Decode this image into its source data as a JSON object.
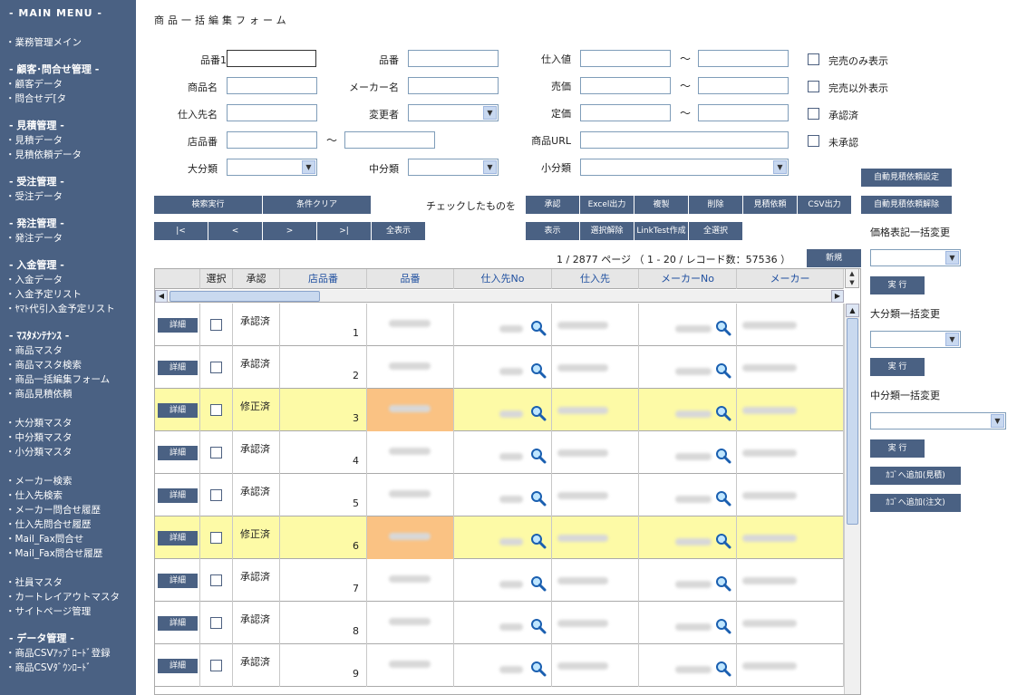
{
  "sidebar": {
    "main_menu": "- MAIN MENU -",
    "top_item": "・業務管理メイン",
    "groups": [
      {
        "title": "- 顧客･問合せ管理 -",
        "items": [
          "・顧客データ",
          "・問合せデ[タ"
        ]
      },
      {
        "title": "- 見積管理 -",
        "items": [
          "・見積データ",
          "・見積依頼データ"
        ]
      },
      {
        "title": "- 受注管理 -",
        "items": [
          "・受注データ"
        ]
      },
      {
        "title": "- 発注管理 -",
        "items": [
          "・発注データ"
        ]
      },
      {
        "title": "- 入金管理 -",
        "items": [
          "・入金データ",
          "・入金予定リスト",
          "・ﾔﾏﾄ代引入金予定リスト"
        ]
      },
      {
        "title": "- ﾏｽﾀﾒﾝﾃﾅﾝｽ -",
        "items": [
          "・商品マスタ",
          "・商品マスタ検索",
          "・商品一括編集フォーム",
          "・商品見積依頼",
          "",
          "・大分類マスタ",
          "・中分類マスタ",
          "・小分類マスタ",
          "",
          "・メーカー検索",
          "・仕入先検索",
          "・メーカー問合せ履歴",
          "・仕入先問合せ履歴",
          "・Mail_Fax問合せ",
          "・Mail_Fax問合せ履歴",
          "",
          "・社員マスタ",
          "・カートレイアウトマスタ",
          "・サイトページ管理"
        ]
      },
      {
        "title": "- データ管理 -",
        "items": [
          "・商品CSVｱｯﾌﾟﾛｰﾄﾞ登録",
          "・商品CSVﾀﾞｳﾝﾛｰﾄﾞ"
        ]
      }
    ]
  },
  "page_title": "商品一括編集フォーム",
  "form": {
    "hinban1": "品番1",
    "hinban": "品番",
    "shiireneh": "仕入値",
    "shohinmei": "商品名",
    "maker_name": "メーカー名",
    "baika": "売価",
    "shiiresaki_name": "仕入先名",
    "henkousha": "変更者",
    "teika": "定価",
    "tenpin_ban": "店品番",
    "shohin_url": "商品URL",
    "dai_bunrui": "大分類",
    "chu_bunrui": "中分類",
    "sho_bunrui": "小分類",
    "tilde": "〜",
    "checkboxes": [
      "完売のみ表示",
      "完売以外表示",
      "承認済",
      "未承認"
    ]
  },
  "buttons": {
    "search": "検索実行",
    "clear": "条件クリア",
    "checked_label": "チェックしたものを",
    "approve": "承認",
    "excel": "Excel出力",
    "duplicate": "複製",
    "delete": "削除",
    "quote_request": "見積依頼",
    "csv": "CSV出力",
    "first": "|<",
    "prev": "<",
    "next": ">",
    "last": ">|",
    "show_all": "全表示",
    "display": "表示",
    "deselect": "選択解除",
    "linktest": "LinkTest作成",
    "select_all": "全選択",
    "new": "新規",
    "auto_quote_set": "自動見積依頼設定",
    "auto_quote_cancel": "自動見積依頼解除",
    "exec": "実 行",
    "cart_add_quote": "ｶｺﾞへ追加(見積)",
    "cart_add_order": "ｶｺﾞへ追加(注文)"
  },
  "pager": {
    "text": "1 / 2877 ページ （ 1 - 20 / レコード数：57536 ）"
  },
  "right_panel": {
    "price_label": "価格表記一括変更",
    "dai_label": "大分類一括変更",
    "chu_label": "中分類一括変更"
  },
  "grid": {
    "headers": [
      "",
      "選択",
      "承認",
      "店品番",
      "品番",
      "仕入先No",
      "仕入先",
      "メーカーNo",
      "メーカー"
    ],
    "detail_label": "詳細",
    "rows": [
      {
        "status": "承認済",
        "num": "1",
        "modified": false
      },
      {
        "status": "承認済",
        "num": "2",
        "modified": false
      },
      {
        "status": "修正済",
        "num": "3",
        "modified": true
      },
      {
        "status": "承認済",
        "num": "4",
        "modified": false
      },
      {
        "status": "承認済",
        "num": "5",
        "modified": false
      },
      {
        "status": "修正済",
        "num": "6",
        "modified": true
      },
      {
        "status": "承認済",
        "num": "7",
        "modified": false
      },
      {
        "status": "承認済",
        "num": "8",
        "modified": false
      },
      {
        "status": "承認済",
        "num": "9",
        "modified": false
      }
    ]
  },
  "colors": {
    "sidebar": "#4a6183",
    "modified_row": "#fdfaa6",
    "orange_cell": "#fac283",
    "header_link": "#2050a0"
  }
}
